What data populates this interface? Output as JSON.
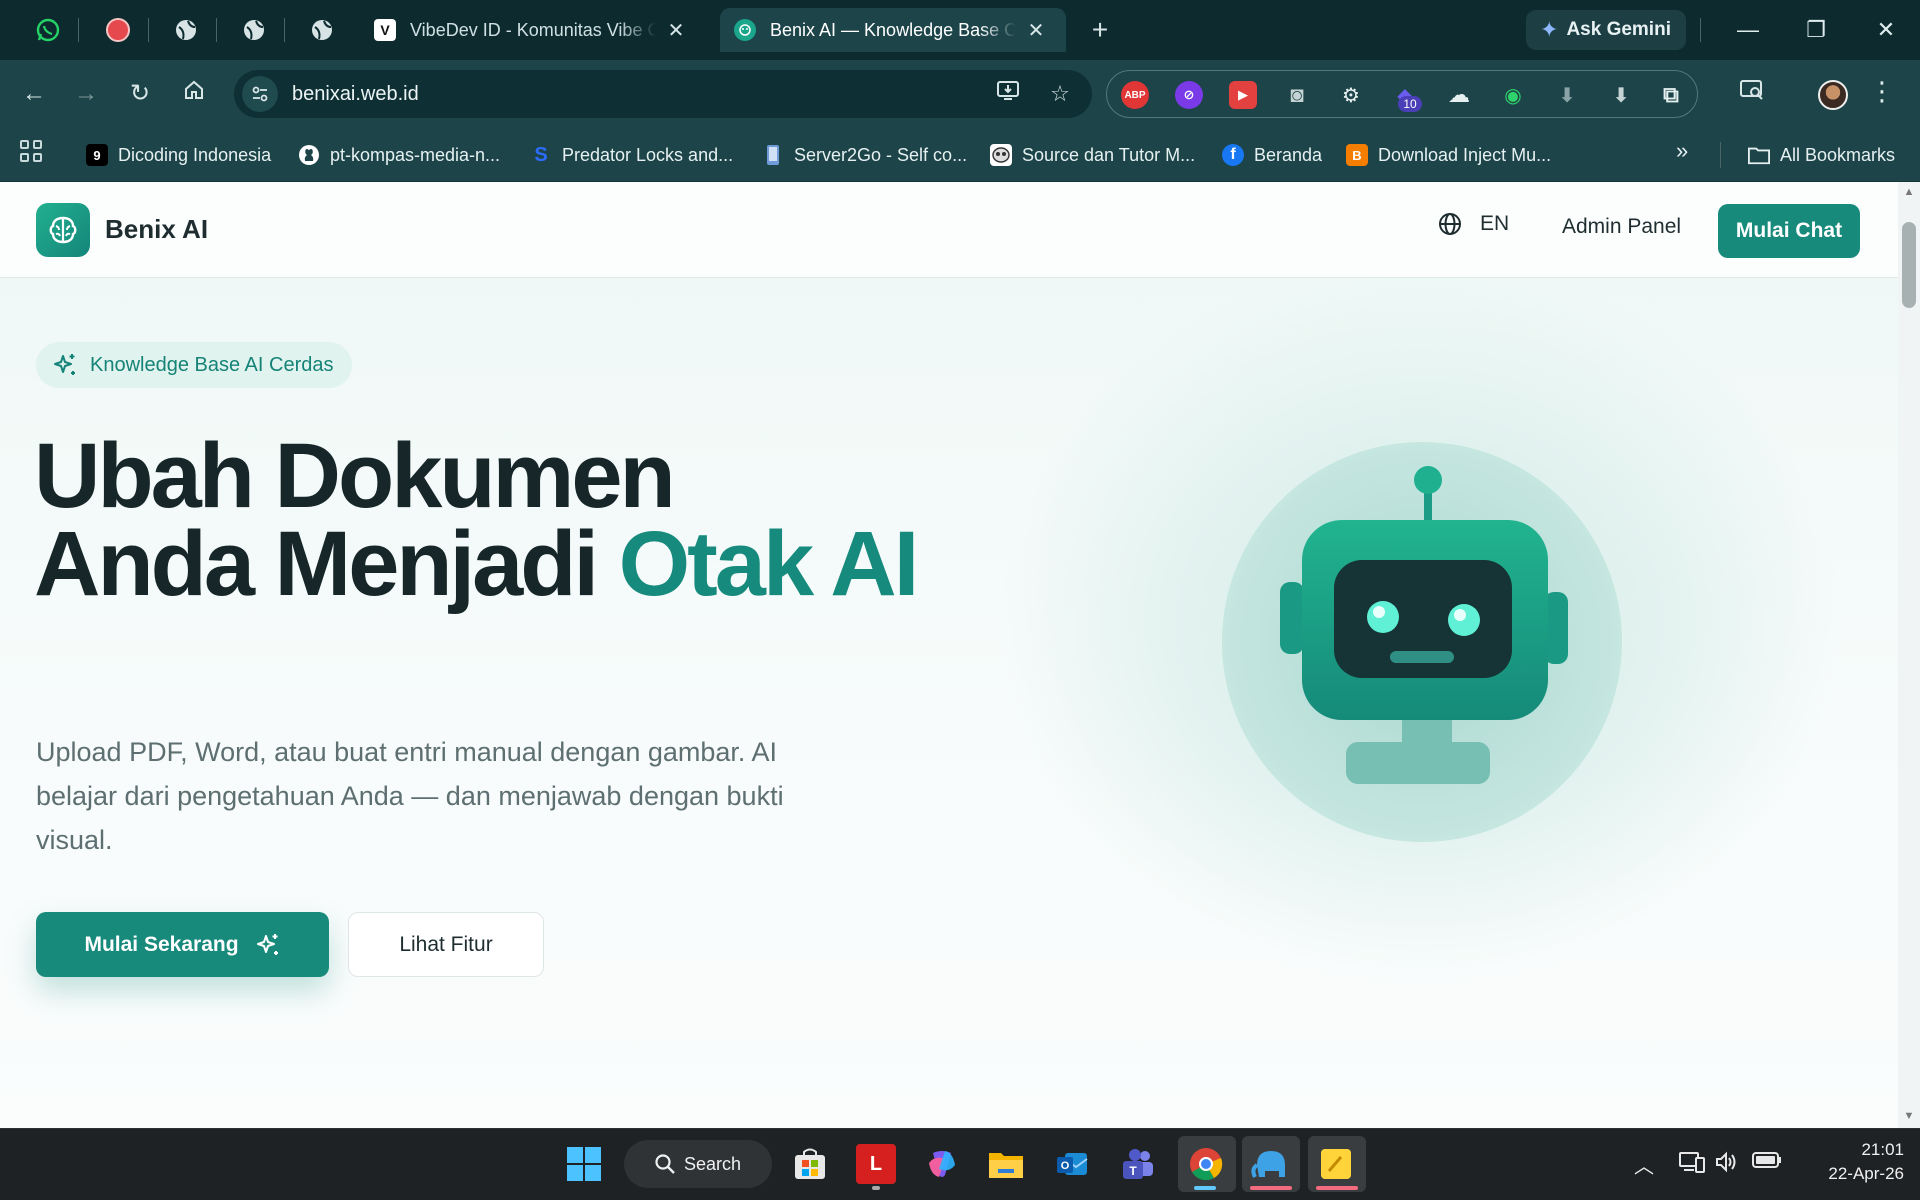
{
  "browser": {
    "tabs": [
      {
        "title": "VibeDev ID - Komunitas Vibe Coding",
        "favicon": "V"
      },
      {
        "title": "Benix AI — Knowledge Base Center",
        "favicon": "benix-icon",
        "active": true
      }
    ],
    "ask_gemini": "Ask Gemini",
    "url": "benixai.web.id",
    "extension_badge": "10",
    "bookmarks": [
      {
        "label": "Dicoding Indonesia",
        "favicon": "9"
      },
      {
        "label": "pt-kompas-media-n...",
        "favicon": "github-icon"
      },
      {
        "label": "Predator Locks and...",
        "favicon": "S"
      },
      {
        "label": "Server2Go - Self co...",
        "favicon": "phone-icon"
      },
      {
        "label": "Source dan Tutor M...",
        "favicon": "mask-icon"
      },
      {
        "label": "Beranda",
        "favicon": "f"
      },
      {
        "label": "Download Inject Mu...",
        "favicon": "B"
      }
    ],
    "all_bookmarks": "All Bookmarks"
  },
  "site": {
    "brand": "Benix AI",
    "lang": "EN",
    "admin_label": "Admin Panel",
    "cta_top": "Mulai Chat",
    "pill": "Knowledge Base AI Cerdas",
    "headline_part1": "Ubah Dokumen",
    "headline_part2": "Anda Menjadi ",
    "headline_accent": "Otak AI",
    "subtext": "Upload PDF, Word, atau buat entri manual dengan gambar. AI belajar dari pengetahuan Anda — dan menjawab dengan bukti visual.",
    "primary_button": "Mulai Sekarang",
    "secondary_button": "Lihat Fitur",
    "accent_color": "#178a7c"
  },
  "taskbar": {
    "search_label": "Search",
    "time": "21:01",
    "date": "22-Apr-26"
  }
}
